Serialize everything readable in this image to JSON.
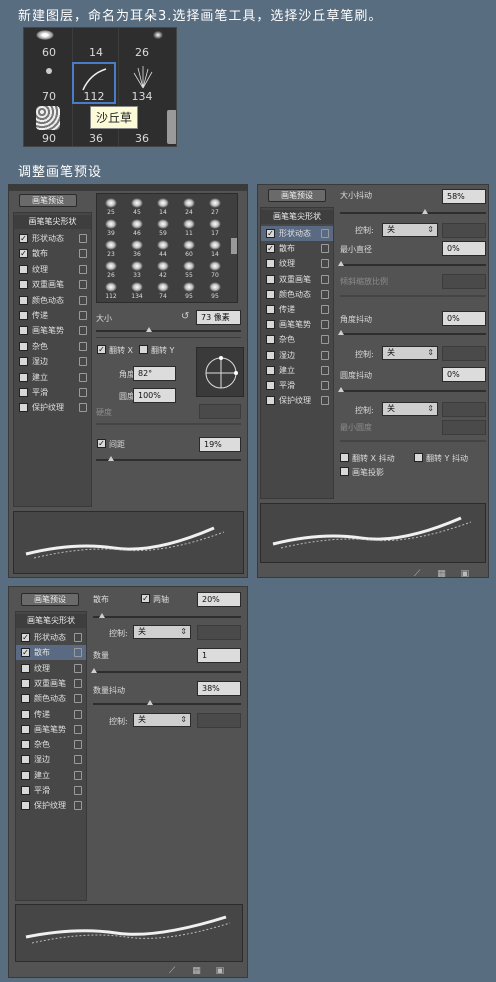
{
  "headings": {
    "step_text": "新建图层，命名为耳朵3.选择画笔工具，选择沙丘草笔刷。",
    "adjust_text": "调整画笔预设"
  },
  "picker": {
    "numbers_row1": [
      "60",
      "14",
      "26"
    ],
    "numbers_row2": [
      "70",
      "112",
      "134"
    ],
    "numbers_row3": [
      "90",
      "36",
      "36"
    ],
    "tooltip": "沙丘草"
  },
  "panel1": {
    "preset_button": "画笔预设",
    "tip_header": "画笔笔尖形状",
    "items": [
      {
        "label": "形状动态",
        "checked": true,
        "check": "✓"
      },
      {
        "label": "散布",
        "checked": true,
        "check": "✓"
      },
      {
        "label": "纹理",
        "checked": false,
        "check": ""
      },
      {
        "label": "双重画笔",
        "checked": false,
        "check": ""
      },
      {
        "label": "颜色动态",
        "checked": false,
        "check": ""
      },
      {
        "label": "传递",
        "checked": false,
        "check": ""
      },
      {
        "label": "画笔笔势",
        "checked": false,
        "check": ""
      },
      {
        "label": "杂色",
        "checked": false,
        "check": ""
      },
      {
        "label": "湿边",
        "checked": false,
        "check": ""
      },
      {
        "label": "建立",
        "checked": false,
        "check": ""
      },
      {
        "label": "平滑",
        "checked": false,
        "check": ""
      },
      {
        "label": "保护纹理",
        "checked": false,
        "check": ""
      }
    ],
    "grid": [
      [
        "25",
        "45",
        "14",
        "24",
        "27"
      ],
      [
        "39",
        "46",
        "59",
        "11",
        "17"
      ],
      [
        "23",
        "36",
        "44",
        "60",
        "14"
      ],
      [
        "26",
        "33",
        "42",
        "55",
        "70"
      ],
      [
        "112",
        "134",
        "74",
        "95",
        "95"
      ]
    ],
    "size_label": "大小",
    "size_value": "73 像素",
    "flip_x": "翻转 X",
    "flip_y": "翻转 Y",
    "flip_check": "✓",
    "angle_label": "角度:",
    "angle_value": "82°",
    "roundness_label": "圆度:",
    "roundness_value": "100%",
    "hardness_label": "硬度",
    "spacing_label": "间距",
    "spacing_value": "19%",
    "spacing_check": "✓"
  },
  "panel2": {
    "preset_button": "画笔预设",
    "tip_header": "画笔笔尖形状",
    "items": [
      {
        "label": "形状动态",
        "check": "✓",
        "active": true
      },
      {
        "label": "散布",
        "check": "✓",
        "active": false
      },
      {
        "label": "纹理",
        "check": "",
        "active": false
      },
      {
        "label": "双重画笔",
        "check": "",
        "active": false
      },
      {
        "label": "颜色动态",
        "check": "",
        "active": false
      },
      {
        "label": "传递",
        "check": "",
        "active": false
      },
      {
        "label": "画笔笔势",
        "check": "",
        "active": false
      },
      {
        "label": "杂色",
        "check": "",
        "active": false
      },
      {
        "label": "湿边",
        "check": "",
        "active": false
      },
      {
        "label": "建立",
        "check": "",
        "active": false
      },
      {
        "label": "平滑",
        "check": "",
        "active": false
      },
      {
        "label": "保护纹理",
        "check": "",
        "active": false
      }
    ],
    "size_jitter_label": "大小抖动",
    "size_jitter_value": "58%",
    "control_label": "控制:",
    "control_value": "关",
    "min_diameter_label": "最小直径",
    "min_diameter_value": "0%",
    "tilt_scale_label": "倾斜缩放比例",
    "angle_jitter_label": "角度抖动",
    "angle_jitter_value": "0%",
    "control2_label": "控制:",
    "control2_value": "关",
    "roundness_jitter_label": "圆度抖动",
    "roundness_jitter_value": "0%",
    "control3_label": "控制:",
    "control3_value": "关",
    "min_roundness_label": "最小圆度",
    "flip_x_jitter": "翻转 X 抖动",
    "flip_y_jitter": "翻转 Y 抖动",
    "brush_projection": "画笔投影"
  },
  "panel3": {
    "preset_button": "画笔预设",
    "tip_header": "画笔笔尖形状",
    "items": [
      {
        "label": "形状动态",
        "check": "✓",
        "active": false
      },
      {
        "label": "散布",
        "check": "✓",
        "active": true
      },
      {
        "label": "纹理",
        "check": "",
        "active": false
      },
      {
        "label": "双重画笔",
        "check": "",
        "active": false
      },
      {
        "label": "颜色动态",
        "check": "",
        "active": false
      },
      {
        "label": "传递",
        "check": "",
        "active": false
      },
      {
        "label": "画笔笔势",
        "check": "",
        "active": false
      },
      {
        "label": "杂色",
        "check": "",
        "active": false
      },
      {
        "label": "湿边",
        "check": "",
        "active": false
      },
      {
        "label": "建立",
        "check": "",
        "active": false
      },
      {
        "label": "平滑",
        "check": "",
        "active": false
      },
      {
        "label": "保护纹理",
        "check": "",
        "active": false
      }
    ],
    "scatter_label": "散布",
    "both_axes_check": "✓",
    "both_axes_label": "两轴",
    "scatter_value": "20%",
    "control_label": "控制:",
    "control_value": "关",
    "count_label": "数量",
    "count_value": "1",
    "count_jitter_label": "数量抖动",
    "count_jitter_value": "38%",
    "control2_label": "控制:",
    "control2_value": "关"
  }
}
